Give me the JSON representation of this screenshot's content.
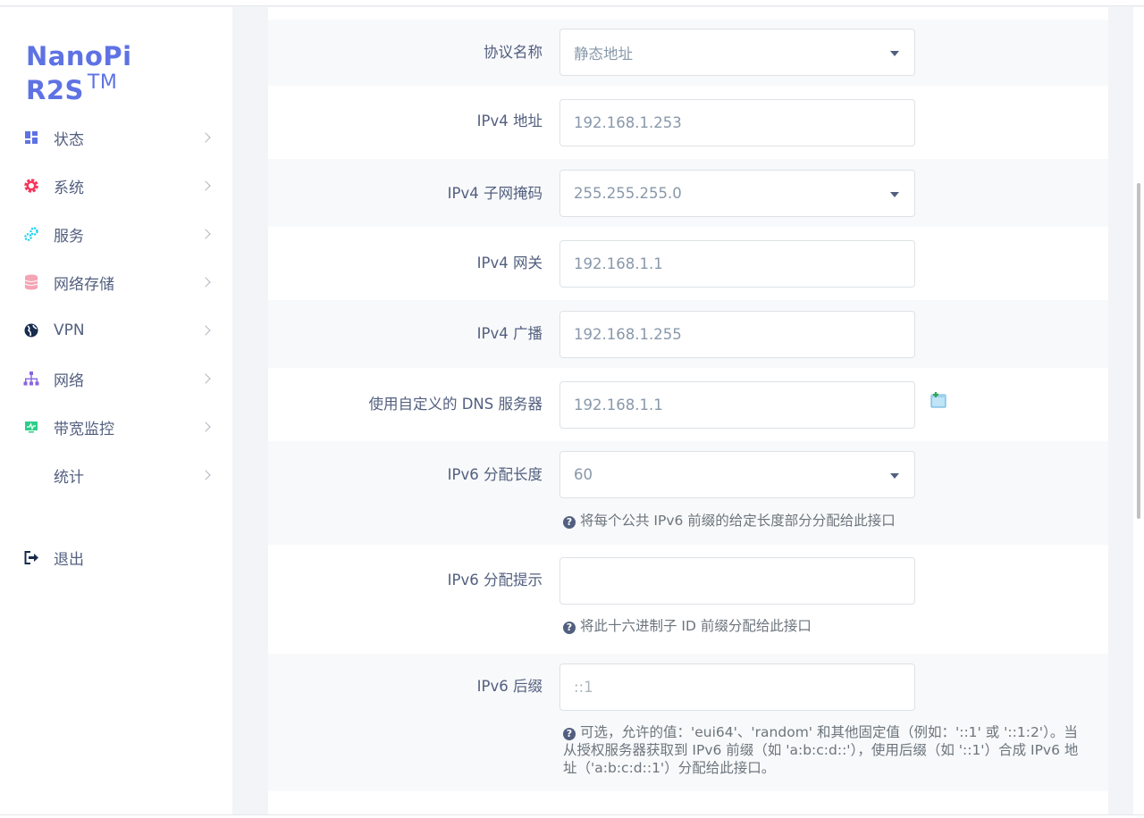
{
  "brand": {
    "name": "NanoPi R2S",
    "mark": "TM"
  },
  "nav": [
    {
      "label": "状态",
      "icon": "dashboard-icon"
    },
    {
      "label": "系统",
      "icon": "gear-icon"
    },
    {
      "label": "服务",
      "icon": "cogs-icon"
    },
    {
      "label": "网络存储",
      "icon": "database-icon"
    },
    {
      "label": "VPN",
      "icon": "globe-icon"
    },
    {
      "label": "网络",
      "icon": "sitemap-icon"
    },
    {
      "label": "带宽监控",
      "icon": "monitor-icon"
    },
    {
      "label": "统计",
      "icon": ""
    }
  ],
  "logout": {
    "label": "退出",
    "icon": "sign-out-icon"
  },
  "form": {
    "protocol": {
      "label": "协议名称",
      "value": "静态地址"
    },
    "ipv4_addr": {
      "label": "IPv4 地址",
      "value": "192.168.1.253"
    },
    "ipv4_mask": {
      "label": "IPv4 子网掩码",
      "value": "255.255.255.0"
    },
    "ipv4_gw": {
      "label": "IPv4 网关",
      "value": "192.168.1.1"
    },
    "ipv4_bcast": {
      "label": "IPv4 广播",
      "value": "192.168.1.255"
    },
    "dns": {
      "label": "使用自定义的 DNS 服务器",
      "value": "192.168.1.1"
    },
    "ip6_len": {
      "label": "IPv6 分配长度",
      "value": "60",
      "hint": "将每个公共 IPv6 前缀的给定长度部分分配给此接口"
    },
    "ip6_hint": {
      "label": "IPv6 分配提示",
      "value": "",
      "hint": "将此十六进制子 ID 前缀分配给此接口"
    },
    "ip6_suffix": {
      "label": "IPv6 后缀",
      "placeholder": "::1",
      "hint_line1": "可选，允许的值：'eui64'、'random' 和其他固定值（例如：'::1' 或 '::1:2'）。当",
      "hint_line2": "从授权服务器获取到 IPv6 前缀（如 'a:b:c:d::'），使用后缀（如 '::1'）合成 IPv6 地",
      "hint_line3": "址（'a:b:c:d::1'）分配给此接口。"
    }
  },
  "colors": {
    "brand": "#5e72e4",
    "row_alt": "#f8f9fa",
    "bg": "#f3f4f8"
  }
}
